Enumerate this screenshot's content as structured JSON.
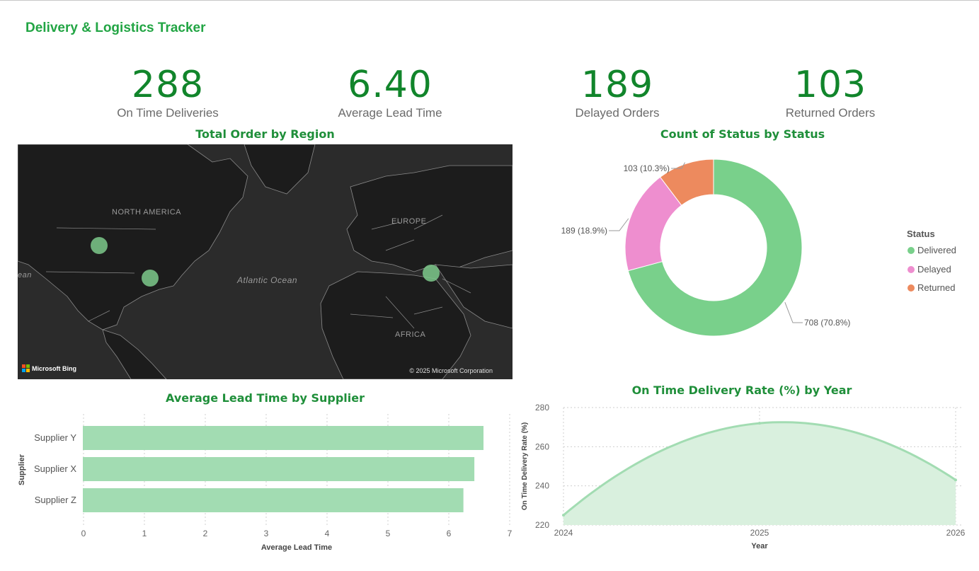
{
  "page": {
    "title": "Delivery & Logistics Tracker"
  },
  "kpis": [
    {
      "value": "288",
      "label": "On Time Deliveries"
    },
    {
      "value": "6.40",
      "label": "Average Lead Time"
    },
    {
      "value": "189",
      "label": "Delayed Orders"
    },
    {
      "value": "103",
      "label": "Returned Orders"
    }
  ],
  "map": {
    "title": "Total Order by Region",
    "labels": {
      "north_america": "NORTH AMERICA",
      "europe": "EUROPE",
      "africa": "AFRICA",
      "atlantic": "Atlantic Ocean",
      "ocean_left": "ean"
    },
    "attribution": "Microsoft Bing",
    "copyright": "© 2025 Microsoft Corporation",
    "colors": {
      "background": "#2b2b2b",
      "land": "#1c1c1c",
      "borders": "#8a8a8a",
      "bubble": "#7dc98b"
    }
  },
  "chart_data": [
    {
      "type": "pie",
      "variant": "donut",
      "title": "Count of Status by Status",
      "legend_title": "Status",
      "legend_position": "right",
      "slices": [
        {
          "name": "Delivered",
          "value": 708,
          "label": "708 (70.8%)",
          "color": "#79d08b"
        },
        {
          "name": "Delayed",
          "value": 189,
          "label": "189 (18.9%)",
          "color": "#ee8ecf"
        },
        {
          "name": "Returned",
          "value": 103,
          "label": "103 (10.3%)",
          "color": "#ed8a5e"
        }
      ]
    },
    {
      "type": "bar",
      "orientation": "horizontal",
      "title": "Average Lead Time by Supplier",
      "xlabel": "Average Lead Time",
      "ylabel": "Supplier",
      "categories": [
        "Supplier Y",
        "Supplier X",
        "Supplier Z"
      ],
      "values": [
        6.57,
        6.42,
        6.24
      ],
      "xlim": [
        0,
        7
      ],
      "xticks": [
        "0",
        "1",
        "2",
        "3",
        "4",
        "5",
        "6",
        "7"
      ],
      "grid": true,
      "color": "#a2dcb2"
    },
    {
      "type": "area",
      "title": "On Time Delivery Rate (%) by Year",
      "xlabel": "Year",
      "ylabel": "On Time Delivery Rate (%)",
      "x": [
        2024,
        2025,
        2026
      ],
      "values": [
        225,
        272,
        243
      ],
      "ylim": [
        220,
        280
      ],
      "yticks": [
        "220",
        "240",
        "260",
        "280"
      ],
      "xticks": [
        "2024",
        "2025",
        "2026"
      ],
      "grid": true,
      "line_color": "#a2dcb2",
      "fill_color": "#d9f0de"
    }
  ]
}
